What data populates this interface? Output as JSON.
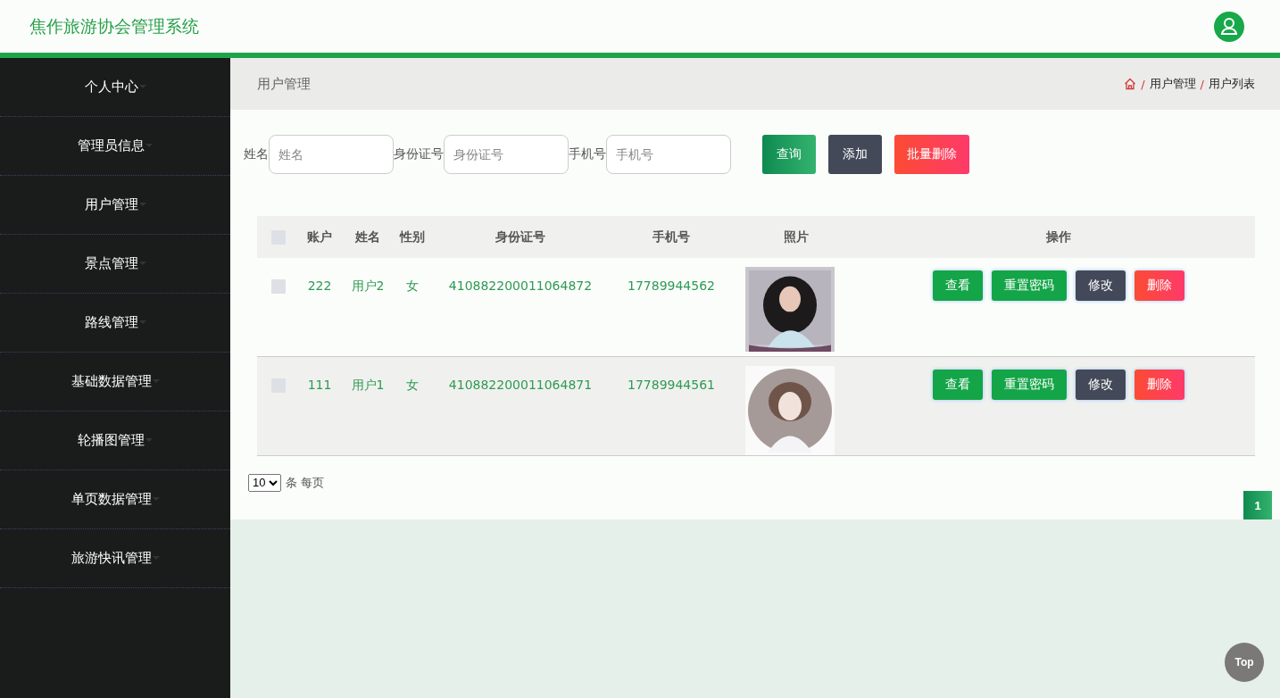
{
  "header": {
    "title": "焦作旅游协会管理系统"
  },
  "sidebar": {
    "items": [
      {
        "label": "个人中心"
      },
      {
        "label": "管理员信息"
      },
      {
        "label": "用户管理"
      },
      {
        "label": "景点管理"
      },
      {
        "label": "路线管理"
      },
      {
        "label": "基础数据管理"
      },
      {
        "label": "轮播图管理"
      },
      {
        "label": "单页数据管理"
      },
      {
        "label": "旅游快讯管理"
      }
    ]
  },
  "page_title": "用户管理",
  "breadcrumb": [
    {
      "separator": "/",
      "label": "用户管理"
    },
    {
      "separator": "/",
      "label": "用户列表"
    }
  ],
  "search": {
    "fields": [
      {
        "label": "姓名",
        "placeholder": "姓名"
      },
      {
        "label": "身份证号",
        "placeholder": "身份证号"
      },
      {
        "label": "手机号",
        "placeholder": "手机号"
      }
    ],
    "buttons": [
      {
        "label": "查询",
        "kind": "query"
      },
      {
        "label": "添加",
        "kind": "add"
      },
      {
        "label": "批量删除",
        "kind": "delete"
      }
    ]
  },
  "table": {
    "all_checked": false,
    "columns": [
      "账户",
      "姓名",
      "性别",
      "身份证号",
      "手机号",
      "照片",
      "操作"
    ],
    "rows": [
      {
        "checked": false,
        "account": "222",
        "name": "用户2",
        "gender": "女",
        "id_number": "410882200011064872",
        "phone": "17789944562",
        "actions": [
          {
            "label": "查看",
            "kind": "view"
          },
          {
            "label": "重置密码",
            "kind": "reset"
          },
          {
            "label": "修改",
            "kind": "edit"
          },
          {
            "label": "删除",
            "kind": "delete"
          }
        ]
      },
      {
        "checked": false,
        "account": "111",
        "name": "用户1",
        "gender": "女",
        "id_number": "410882200011064871",
        "phone": "17789944561",
        "actions": [
          {
            "label": "查看",
            "kind": "view"
          },
          {
            "label": "重置密码",
            "kind": "reset"
          },
          {
            "label": "修改",
            "kind": "edit"
          },
          {
            "label": "删除",
            "kind": "delete"
          }
        ]
      }
    ]
  },
  "pagination": {
    "page_size": "10",
    "page_size_label": "条 每页",
    "pages": [
      {
        "label": "1",
        "selected": true
      }
    ]
  },
  "top_button": "Top"
}
